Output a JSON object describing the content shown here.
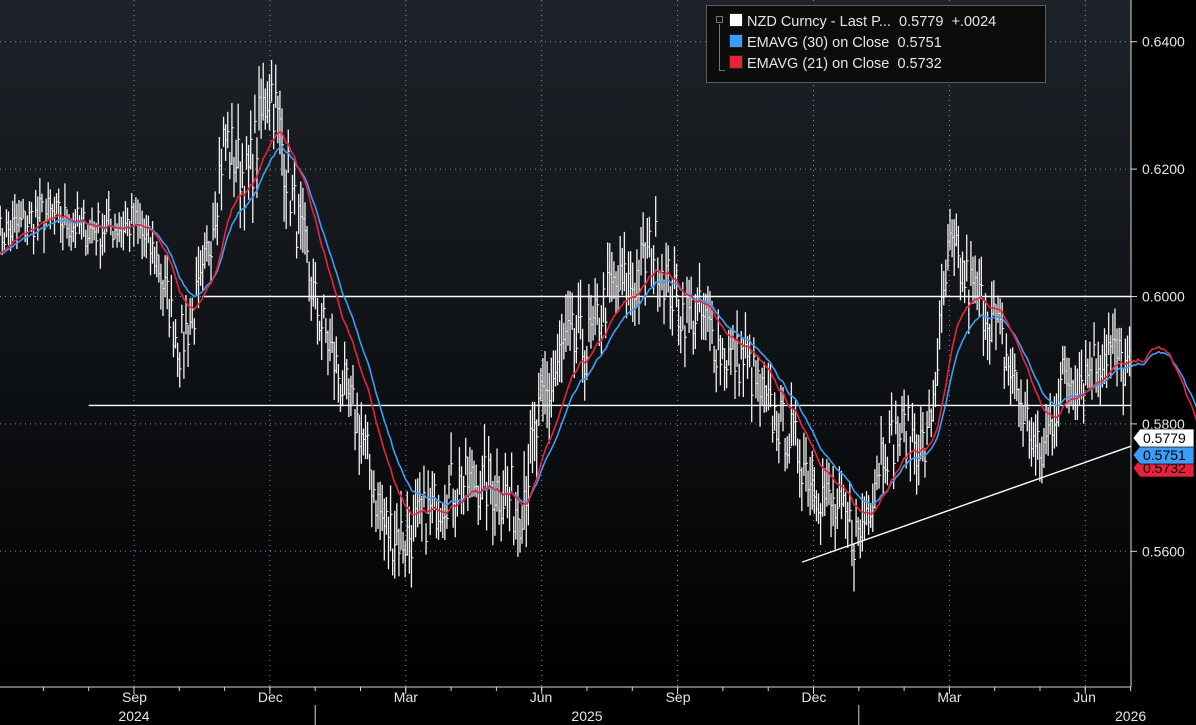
{
  "chart_data": {
    "type": "line",
    "legend": [
      {
        "label": "NZD Curncy - Last P...",
        "value": "0.5779",
        "change": "+.0024",
        "color": "#ffffff"
      },
      {
        "label": "EMAVG (30)  on Close",
        "value": "0.5751",
        "color": "#3d9cf5"
      },
      {
        "label": "EMAVG (21)  on Close",
        "value": "0.5732",
        "color": "#e8223a"
      }
    ],
    "legend_placement": "top-right",
    "y_axis": {
      "position": "right",
      "ylim": [
        0.547,
        0.6665
      ],
      "ticks": [
        0.56,
        0.58,
        0.6,
        0.62,
        0.64
      ],
      "tick_labels": [
        "0.5600",
        "0.5800",
        "0.6000",
        "0.6200",
        "0.6400"
      ]
    },
    "x_axis": {
      "month_ticks": [
        "Sep",
        "Dec",
        "Mar",
        "Jun",
        "Sep",
        "Dec",
        "Mar",
        "Jun"
      ],
      "year_labels": [
        "2024",
        "2025",
        "2026"
      ]
    },
    "grid": true,
    "series": [
      {
        "name": "NZD Curncy - Last P...",
        "style": "hlc-bars",
        "x_months": [
          0.0,
          0.5,
          1.0,
          1.5,
          2.0,
          2.5,
          3.0,
          3.5,
          4.0,
          4.5,
          5.0,
          5.5,
          6.0,
          6.5,
          7.0,
          7.5,
          8.0,
          8.5,
          9.0,
          9.5,
          10.0,
          10.5,
          11.0,
          11.5,
          12.0,
          12.5,
          13.0,
          13.5,
          14.0,
          14.5,
          15.0,
          15.5,
          16.0,
          16.5,
          17.0,
          17.5,
          18.0,
          18.5,
          19.0,
          19.5,
          20.0,
          20.5,
          21.0,
          21.5,
          22.0,
          22.5,
          23.0,
          23.5,
          24.0,
          24.5
        ],
        "close": [
          0.6115,
          0.606,
          0.592,
          0.601,
          0.625,
          0.618,
          0.634,
          0.615,
          0.599,
          0.588,
          0.579,
          0.564,
          0.562,
          0.566,
          0.57,
          0.571,
          0.57,
          0.567,
          0.582,
          0.592,
          0.592,
          0.601,
          0.602,
          0.608,
          0.598,
          0.597,
          0.591,
          0.59,
          0.582,
          0.578,
          0.571,
          0.566,
          0.562,
          0.576,
          0.579,
          0.576,
          0.607,
          0.601,
          0.596,
          0.585,
          0.574,
          0.587,
          0.588,
          0.592,
          0.588,
          0.595,
          0.582,
          0.568,
          0.572,
          0.5779
        ],
        "ranges": [
          0.0045,
          0.005,
          0.006,
          0.006,
          0.007,
          0.007,
          0.008,
          0.007,
          0.006,
          0.006,
          0.006,
          0.007,
          0.007,
          0.006,
          0.006,
          0.006,
          0.007,
          0.008,
          0.008,
          0.008,
          0.007,
          0.006,
          0.007,
          0.007,
          0.006,
          0.006,
          0.006,
          0.006,
          0.006,
          0.006,
          0.006,
          0.006,
          0.007,
          0.006,
          0.006,
          0.006,
          0.007,
          0.006,
          0.006,
          0.006,
          0.006,
          0.006,
          0.006,
          0.006,
          0.006,
          0.006,
          0.006,
          0.006,
          0.006,
          0.006
        ]
      },
      {
        "name": "EMAVG (30)  on Close",
        "style": "ema",
        "period": 30
      },
      {
        "name": "EMAVG (21)  on Close",
        "style": "ema",
        "period": 21
      }
    ],
    "annotations": [
      {
        "type": "hline",
        "value": 0.6,
        "from_month": 1.5,
        "to_month": 27.0
      },
      {
        "type": "hline",
        "value": 0.5829,
        "from_month": -1.0,
        "to_month": 27.0
      },
      {
        "type": "trendline",
        "from": [
          14.75,
          0.5583
        ],
        "to": [
          27.0,
          0.5765
        ]
      }
    ],
    "last_value_tags": [
      {
        "value": "0.5779",
        "level": 0.5779,
        "bg": "#ffffff",
        "fg": "#000000"
      },
      {
        "value": "0.5751",
        "level": 0.5751,
        "bg": "#3d9cf5",
        "fg": "#000000"
      },
      {
        "value": "0.5732",
        "level": 0.5732,
        "bg": "#e8223a",
        "fg": "#000000"
      }
    ]
  }
}
